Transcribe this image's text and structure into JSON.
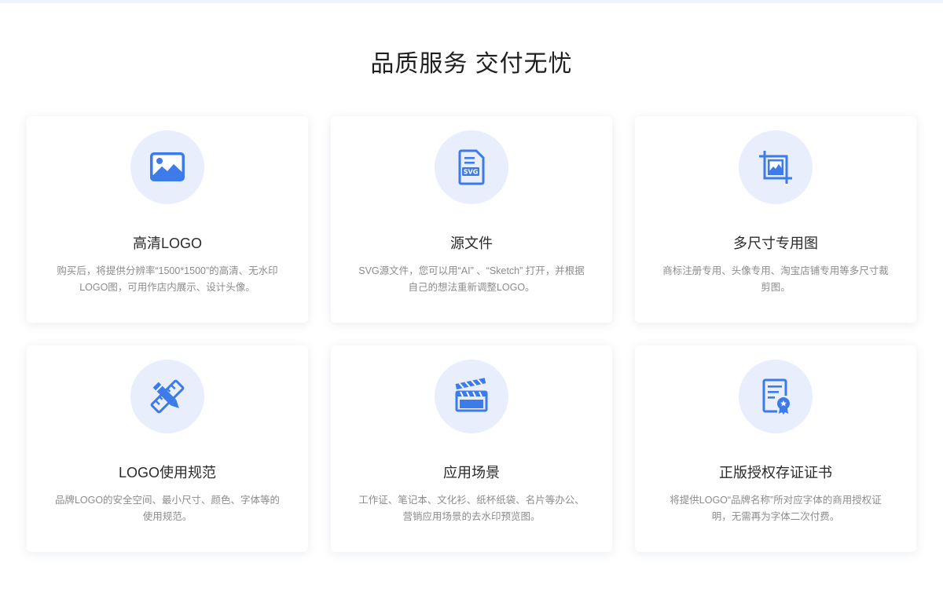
{
  "section": {
    "title": "品质服务 交付无忧"
  },
  "cards": [
    {
      "icon": "image-icon",
      "title": "高清LOGO",
      "desc": "购买后，将提供分辨率“1500*1500”的高清、无水印LOGO图，可用作店内展示、设计头像。"
    },
    {
      "icon": "svg-file-icon",
      "icon_text": "SVG",
      "title": "源文件",
      "desc": "SVG源文件，您可以用“AI” 、“Sketch” 打开，并根据自己的想法重新调整LOGO。"
    },
    {
      "icon": "crop-image-icon",
      "title": "多尺寸专用图",
      "desc": "商标注册专用、头像专用、淘宝店铺专用等多尺寸裁剪图。"
    },
    {
      "icon": "ruler-pencil-icon",
      "title": "LOGO使用规范",
      "desc": "品牌LOGO的安全空间、最小尺寸、颜色、字体等的使用规范。"
    },
    {
      "icon": "clapperboard-icon",
      "title": "应用场景",
      "desc": "工作证、笔记本、文化衫、纸杯纸袋、名片等办公、营销应用场景的去水印预览图。"
    },
    {
      "icon": "certificate-icon",
      "title": "正版授权存证证书",
      "desc": "将提供LOGO“品牌名称”所对应字体的商用授权证明，无需再为字体二次付费。"
    }
  ],
  "colors": {
    "accent": "#3d7be8",
    "icon_bg": "#e8eefc",
    "title_text": "#2a2a2a",
    "desc_text": "#8c8c8c"
  }
}
